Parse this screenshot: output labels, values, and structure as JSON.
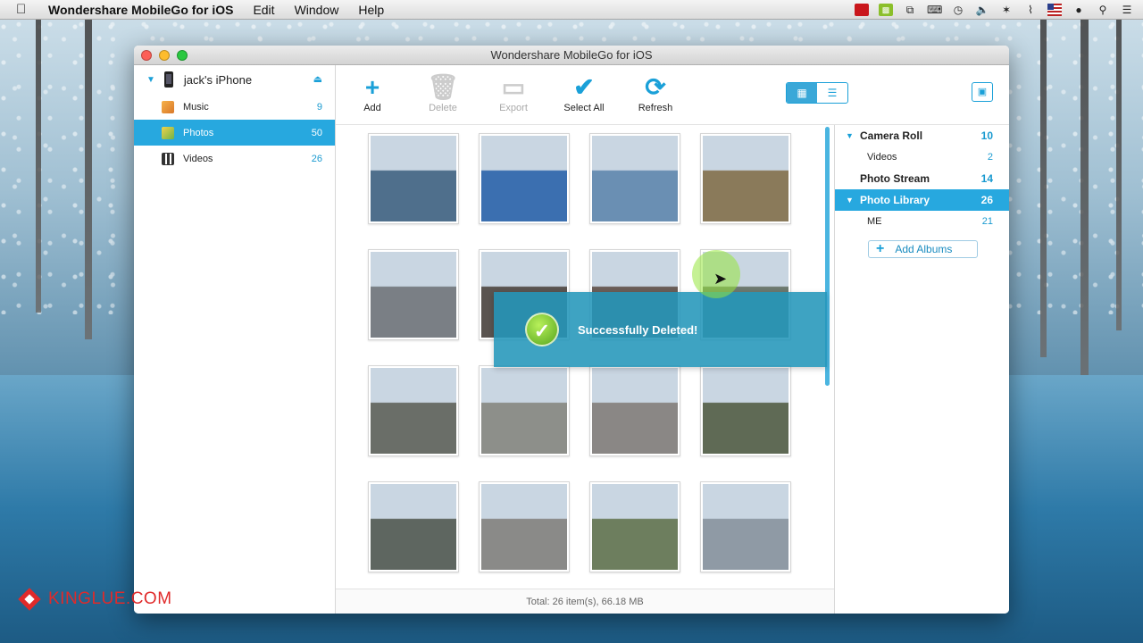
{
  "menubar": {
    "app_name": "Wondershare MobileGo for iOS",
    "items": [
      "Edit",
      "Window",
      "Help"
    ]
  },
  "window": {
    "title": "Wondershare MobileGo for iOS"
  },
  "sidebar": {
    "device": "jack's iPhone",
    "items": [
      {
        "label": "Music",
        "count": "9",
        "icon": "music-icon"
      },
      {
        "label": "Photos",
        "count": "50",
        "icon": "photos-icon",
        "active": true
      },
      {
        "label": "Videos",
        "count": "26",
        "icon": "videos-icon"
      }
    ]
  },
  "toolbar": {
    "add_label": "Add",
    "delete_label": "Delete",
    "export_label": "Export",
    "select_all_label": "Select All",
    "refresh_label": "Refresh",
    "view_mode": "grid"
  },
  "photos": {
    "thumbnails": [
      "#4f6f8c",
      "#3b6fb0",
      "#6a8fb3",
      "#8a7a5a",
      "#7a7f85",
      "#5a5450",
      "#6b5e58",
      "#6e7a70",
      "#6a6e68",
      "#8d8f8a",
      "#8a8785",
      "#5f6a55",
      "#5e6660",
      "#8a8a88",
      "#6d7e5e",
      "#8f9aa5"
    ]
  },
  "status": {
    "total": "Total: 26 item(s), 66.18 MB"
  },
  "albums": {
    "camera_roll": {
      "label": "Camera Roll",
      "count": "10"
    },
    "camera_videos": {
      "label": "Videos",
      "count": "2"
    },
    "photo_stream": {
      "label": "Photo Stream",
      "count": "14"
    },
    "photo_library": {
      "label": "Photo Library",
      "count": "26"
    },
    "me": {
      "label": "ME",
      "count": "21"
    },
    "add_albums_label": "Add Albums"
  },
  "toast": {
    "message": "Successfully Deleted!"
  },
  "watermark": {
    "text": "KINGLUE.COM"
  },
  "colors": {
    "accent": "#27a8df",
    "toast": "#2396ba",
    "watermark": "#e02a2a"
  }
}
